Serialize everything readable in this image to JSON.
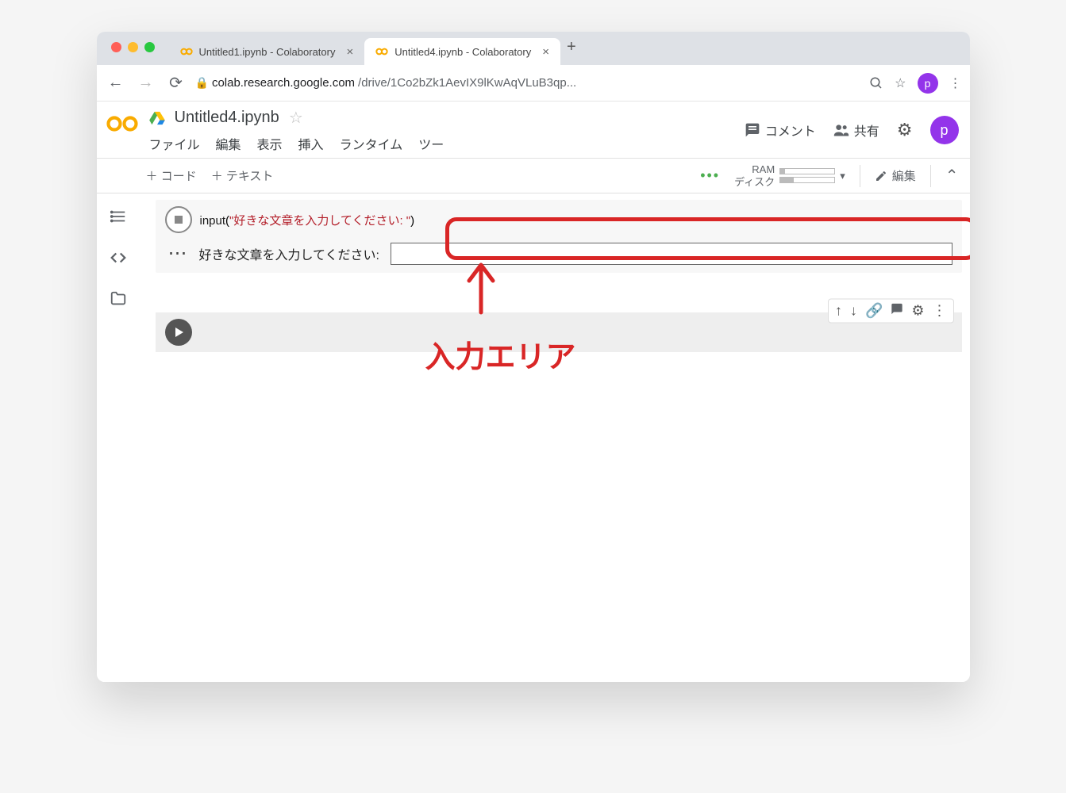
{
  "browser": {
    "tabs": [
      {
        "title": "Untitled1.ipynb - Colaboratory"
      },
      {
        "title": "Untitled4.ipynb - Colaboratory"
      }
    ],
    "url_host": "colab.research.google.com",
    "url_path": "/drive/1Co2bZk1AevIX9lKwAqVLuB3qp...",
    "avatar_letter": "p"
  },
  "colab": {
    "notebook_title": "Untitled4.ipynb",
    "menu": {
      "file": "ファイル",
      "edit": "編集",
      "view": "表示",
      "insert": "挿入",
      "runtime": "ランタイム",
      "tools": "ツー"
    },
    "header_actions": {
      "comment": "コメント",
      "share": "共有"
    },
    "toolbar": {
      "code": "コード",
      "text": "テキスト",
      "ram": "RAM",
      "disk": "ディスク",
      "edit": "編集"
    }
  },
  "cell1": {
    "code_func": "input",
    "code_open": "(",
    "code_string": "\"好きな文章を入力してください: \"",
    "code_close": ")",
    "output_prompt": "好きな文章を入力してください: "
  },
  "annotation": {
    "label": "入力エリア"
  }
}
